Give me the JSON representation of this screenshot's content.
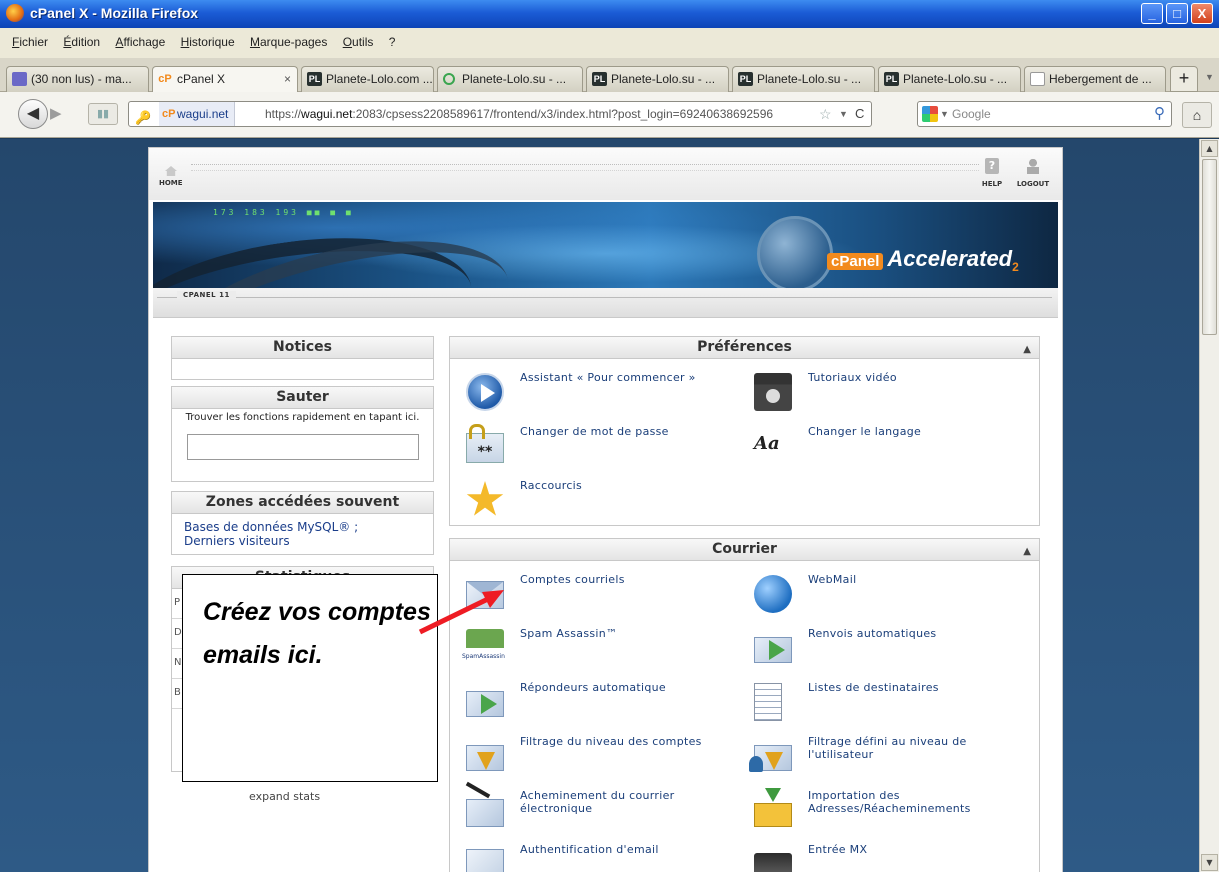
{
  "window": {
    "title": "cPanel X - Mozilla Firefox",
    "controls": {
      "minimize": "_",
      "maximize": "□",
      "close": "X"
    }
  },
  "menu": [
    "Fichier",
    "Édition",
    "Affichage",
    "Historique",
    "Marque-pages",
    "Outils",
    "?"
  ],
  "tabs": [
    {
      "label": "(30 non lus) - ma...",
      "icon": "mail-icon"
    },
    {
      "label": "cPanel X",
      "icon": "cpanel-icon",
      "active": true,
      "close": "×"
    },
    {
      "label": "Planete-Lolo.com ...",
      "icon": "pl-icon"
    },
    {
      "label": "Planete-Lolo.su - ...",
      "icon": "loading-icon"
    },
    {
      "label": "Planete-Lolo.su - ...",
      "icon": "pl-icon"
    },
    {
      "label": "Planete-Lolo.su - ...",
      "icon": "pl-icon"
    },
    {
      "label": "Planete-Lolo.su - ...",
      "icon": "pl-icon"
    },
    {
      "label": "Hebergement de ...",
      "icon": "document-icon"
    }
  ],
  "nav": {
    "site_badge": "wagui.net",
    "url_prefix": "https://",
    "url_host": "wagui.net",
    "url_rest": ":2083/cpsess2208589617/frontend/x3/index.html?post_login=69240638692596",
    "search_placeholder": "Google"
  },
  "cpanel": {
    "home_label": "HOME",
    "help_label": "HELP",
    "logout_label": "LOGOUT",
    "version_label": "CPANEL 11",
    "logo_badge": "cPanel",
    "logo_word": "Accelerated",
    "logo_sub": "2",
    "banner_lights": "173  183  193  ■■  ■  ■"
  },
  "sidebar": {
    "notices_title": "Notices",
    "sauter_title": "Sauter",
    "sauter_desc": "Trouver les fonctions rapidement en tapant ici.",
    "search_value": "",
    "frequent_title": "Zones accédées souvent",
    "frequent_links": [
      "Bases de données MySQL® ;",
      "Derniers visiteurs"
    ],
    "stats_title": "Statistiques",
    "expand_label": "expand stats"
  },
  "preferences": {
    "title": "Préférences",
    "collapse": "▲",
    "items": [
      {
        "label": "Assistant « Pour commencer »",
        "icon": "play-icon"
      },
      {
        "label": "Tutoriaux vidéo",
        "icon": "video-icon"
      },
      {
        "label": "Changer de mot de passe",
        "icon": "password-lock-icon"
      },
      {
        "label": "Changer le langage",
        "icon": "language-icon"
      },
      {
        "label": "Raccourcis",
        "icon": "star-icon"
      }
    ]
  },
  "mail": {
    "title": "Courrier",
    "collapse": "▲",
    "items": [
      {
        "label": "Comptes courriels",
        "icon": "envelope-icon"
      },
      {
        "label": "WebMail",
        "icon": "globe-mail-icon"
      },
      {
        "label": "Spam Assassin™",
        "icon": "spamassassin-icon"
      },
      {
        "label": "Renvois automatiques",
        "icon": "forward-icon"
      },
      {
        "label": "Répondeurs automatique",
        "icon": "autoresponder-icon"
      },
      {
        "label": "Listes de destinataires",
        "icon": "mailing-list-icon"
      },
      {
        "label": "Filtrage du niveau des comptes",
        "icon": "account-filter-icon"
      },
      {
        "label": "Filtrage défini au niveau de l'utilisateur",
        "icon": "user-filter-icon"
      },
      {
        "label": "Acheminement du courrier électronique",
        "icon": "mail-routing-icon"
      },
      {
        "label": "Importation des Adresses/Réacheminements",
        "icon": "import-icon"
      },
      {
        "label": "Authentification d'email",
        "icon": "email-auth-icon"
      },
      {
        "label": "Entrée MX",
        "icon": "mx-entry-icon"
      }
    ]
  },
  "annotation": {
    "text": "Créez vos comptes emails ici.",
    "arrow_color": "#ee1c24"
  },
  "colors": {
    "accent": "#f28a1d",
    "link": "#1a3e79",
    "page_bg": "#24476c"
  }
}
